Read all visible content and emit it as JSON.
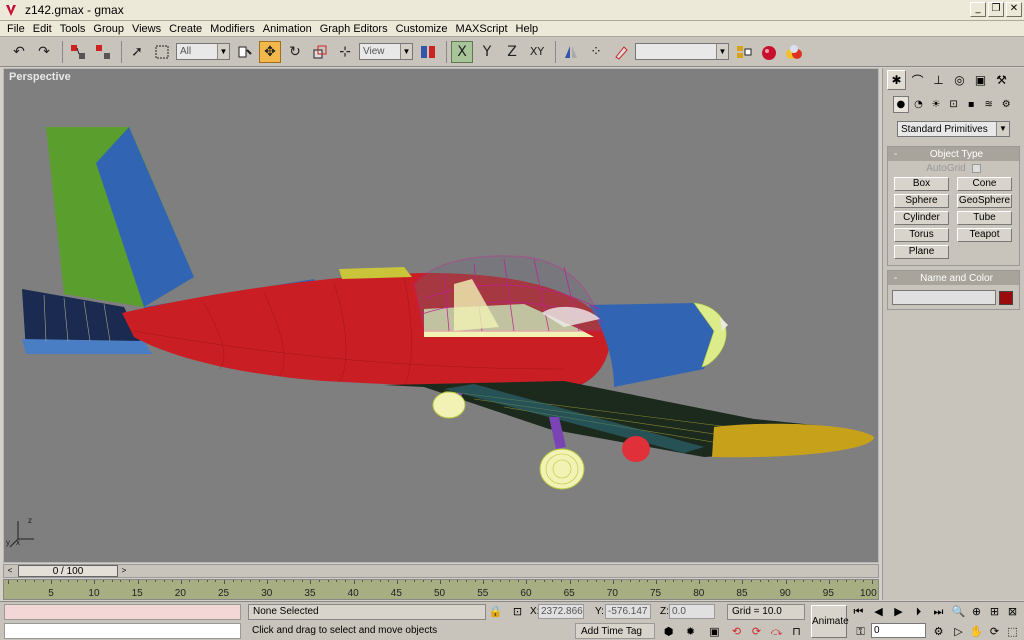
{
  "window": {
    "title": "z142.gmax - gmax",
    "minimize": "_",
    "restore": "❐",
    "close": "✕"
  },
  "menu": [
    "File",
    "Edit",
    "Tools",
    "Group",
    "Views",
    "Create",
    "Modifiers",
    "Animation",
    "Graph Editors",
    "Customize",
    "MAXScript",
    "Help"
  ],
  "toolbar": {
    "selection_filter": "All",
    "ref_coord": "View",
    "named_selection": "",
    "axis_x": "X",
    "axis_y": "Y",
    "axis_z": "Z",
    "axis_xy": "XY"
  },
  "viewport": {
    "label": "Perspective",
    "axis_x": "x",
    "axis_y": "y",
    "axis_z": "z"
  },
  "command_panel": {
    "category": "Standard Primitives",
    "object_type": {
      "header": "Object Type",
      "autogrid": "AutoGrid",
      "buttons": [
        "Box",
        "Cone",
        "Sphere",
        "GeoSphere",
        "Cylinder",
        "Tube",
        "Torus",
        "Teapot",
        "Plane"
      ]
    },
    "name_and_color": {
      "header": "Name and Color",
      "name": "",
      "color": "#9c0b0b"
    }
  },
  "time": {
    "slider": "0 / 100",
    "ticks": [
      "5",
      "10",
      "15",
      "20",
      "25",
      "30",
      "35",
      "40",
      "45",
      "50",
      "55",
      "60",
      "65",
      "70",
      "75",
      "80",
      "85",
      "90",
      "95",
      "100"
    ]
  },
  "status": {
    "selection": "None Selected",
    "prompt": "Click and drag to select and move objects",
    "x_label": "X:",
    "x_value": "2372.866",
    "y_label": "Y:",
    "y_value": "-576.147",
    "z_label": "Z:",
    "z_value": "0.0",
    "grid": "Grid = 10.0",
    "add_time_tag": "Add Time Tag",
    "animate": "Animate",
    "frame": "0"
  }
}
